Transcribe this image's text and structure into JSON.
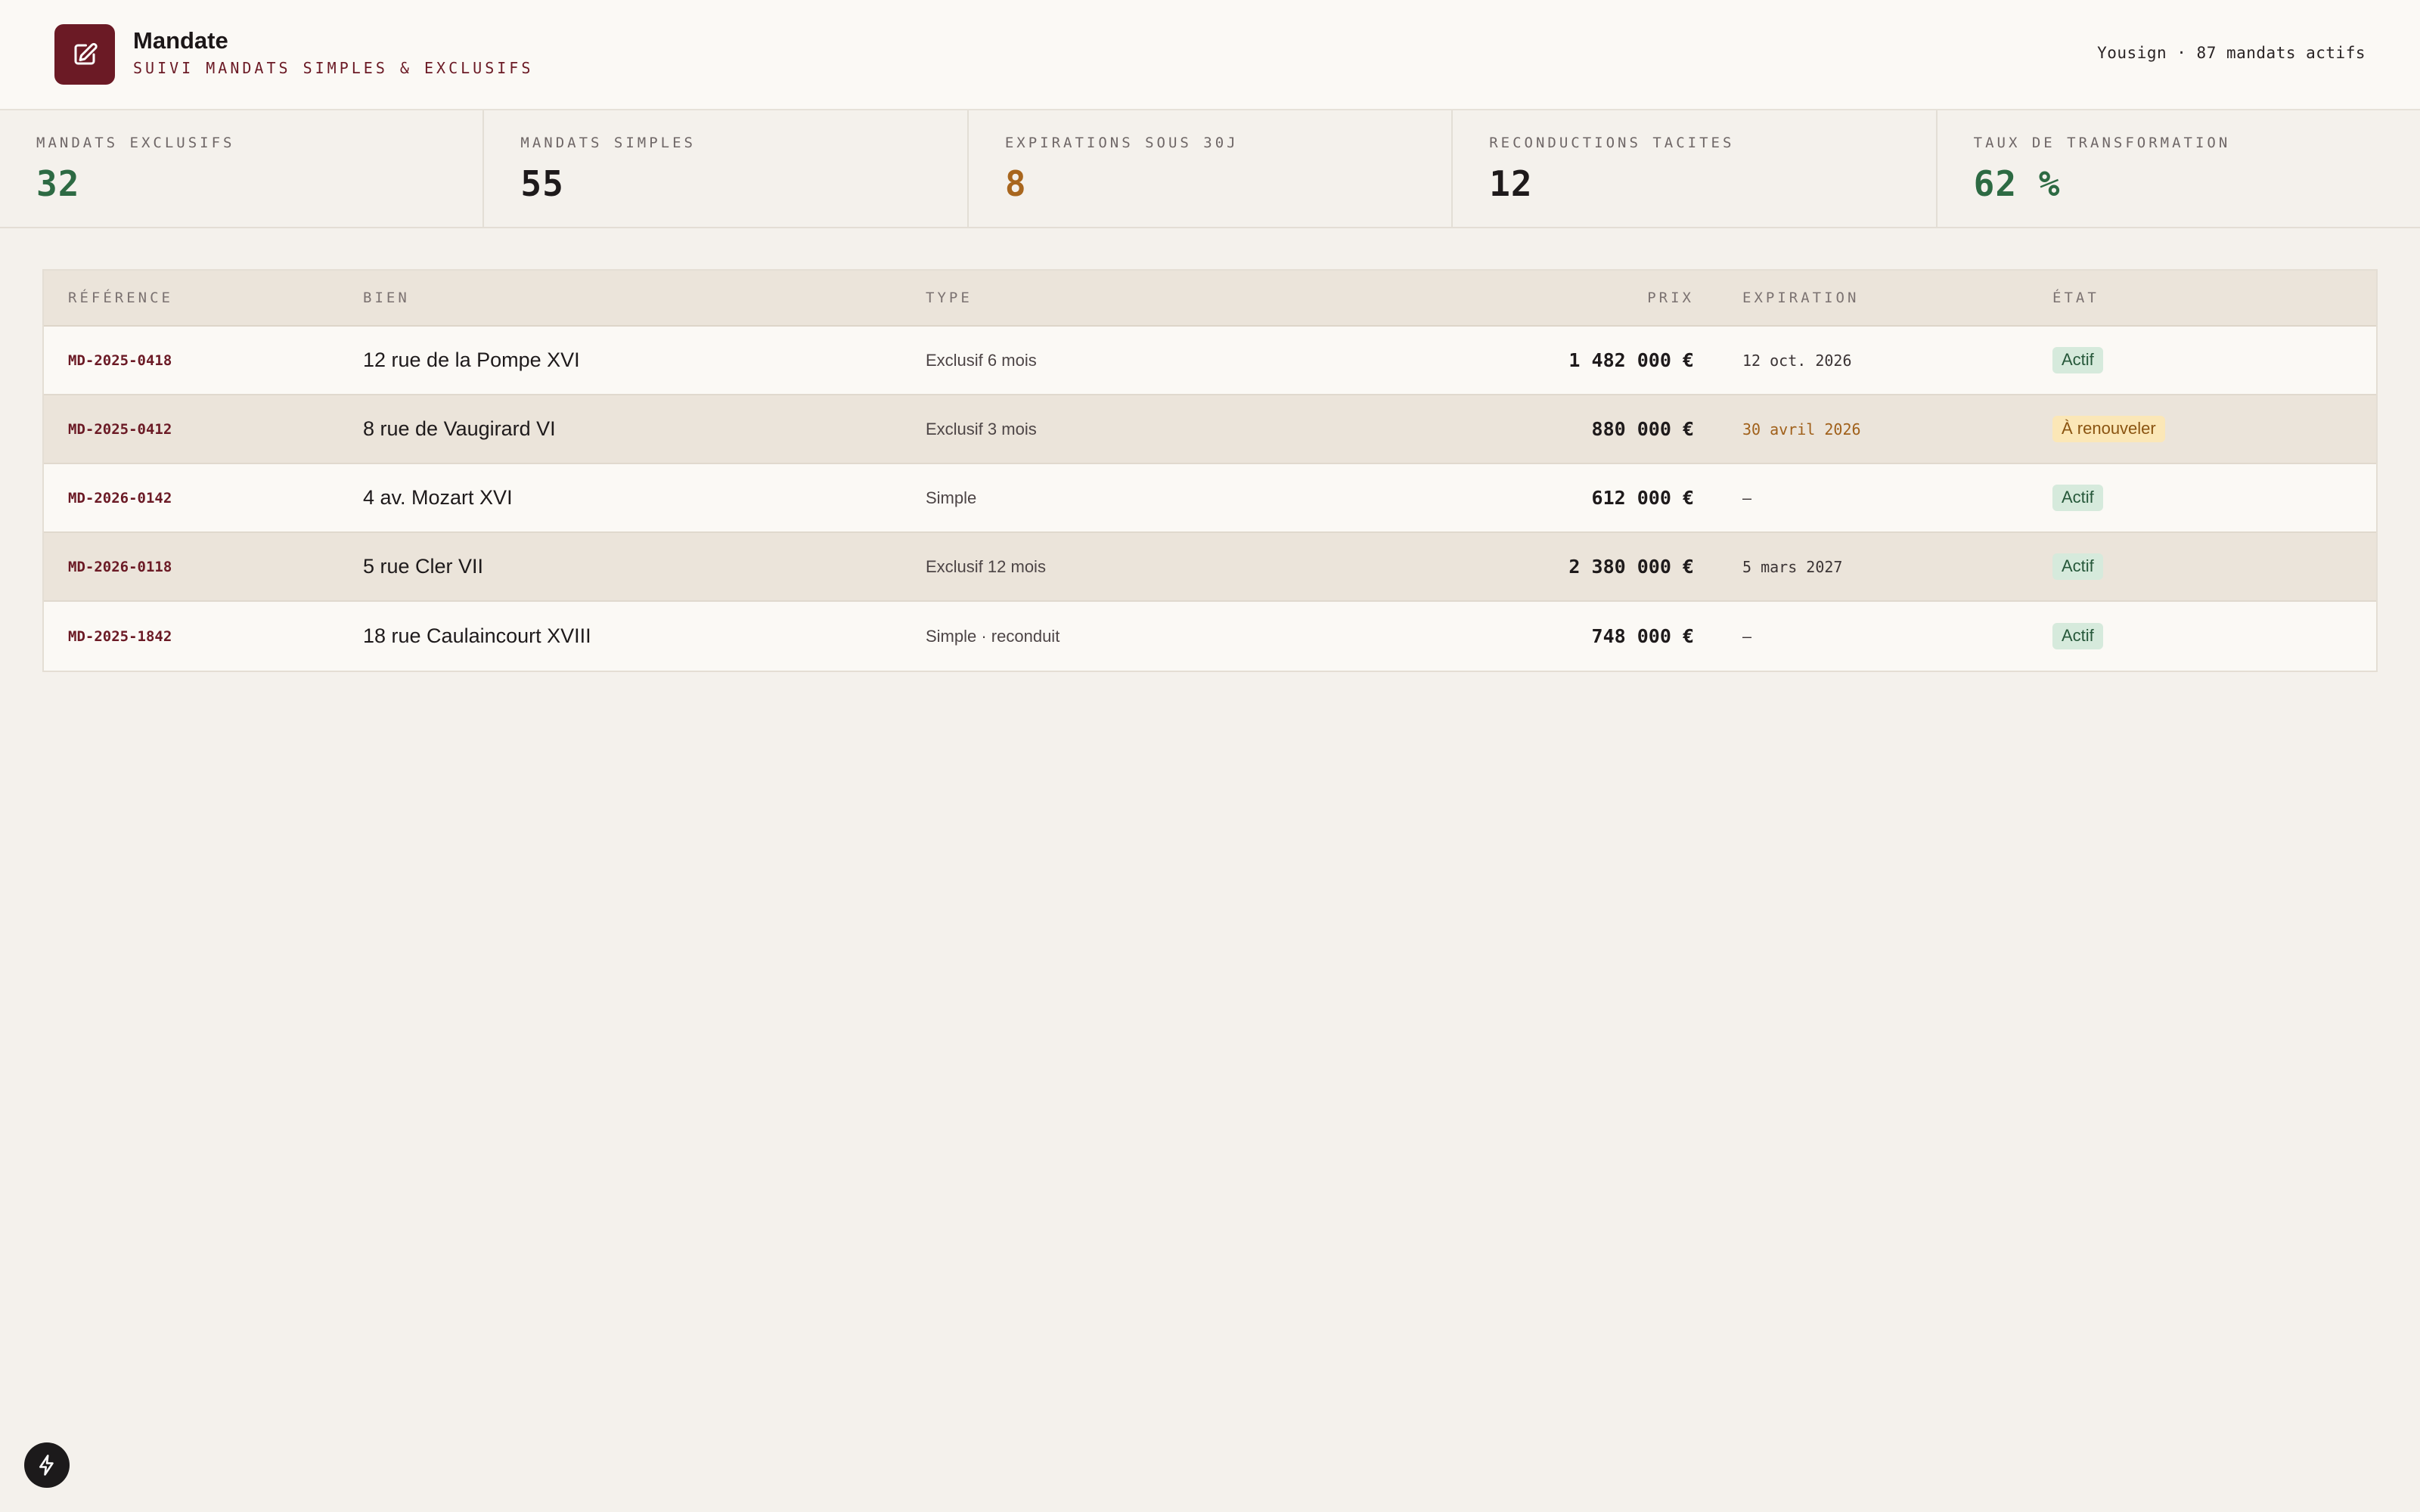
{
  "app": {
    "title": "Mandate",
    "subtitle": "SUIVI MANDATS SIMPLES & EXCLUSIFS",
    "meta": "Yousign · 87 mandats actifs",
    "logo_icon": "document-edit-icon",
    "brand_color": "#6b1a25"
  },
  "kpis": [
    {
      "label": "MANDATS EXCLUSIFS",
      "value": "32",
      "color": "#2d6a43"
    },
    {
      "label": "MANDATS SIMPLES",
      "value": "55",
      "color": "#1e1a1b"
    },
    {
      "label": "EXPIRATIONS SOUS 30J",
      "value": "8",
      "color": "#a8661e"
    },
    {
      "label": "RECONDUCTIONS TACITES",
      "value": "12",
      "color": "#1e1a1b"
    },
    {
      "label": "TAUX DE TRANSFORMATION",
      "value": "62 %",
      "color": "#2d6a43"
    }
  ],
  "table": {
    "headers": {
      "ref": "RÉFÉRENCE",
      "bien": "BIEN",
      "type": "TYPE",
      "prix": "PRIX",
      "expiration": "EXPIRATION",
      "etat": "ÉTAT"
    },
    "rows": [
      {
        "ref": "MD-2025-0418",
        "bien": "12 rue de la Pompe XVI",
        "type": "Exclusif 6 mois",
        "prix": "1 482 000 €",
        "expiration": "12 oct. 2026",
        "expiration_warn": false,
        "etat": "Actif",
        "etat_status": "ok"
      },
      {
        "ref": "MD-2025-0412",
        "bien": "8 rue de Vaugirard VI",
        "type": "Exclusif 3 mois",
        "prix": "880 000 €",
        "expiration": "30 avril 2026",
        "expiration_warn": true,
        "etat": "À renouveler",
        "etat_status": "warn"
      },
      {
        "ref": "MD-2026-0142",
        "bien": "4 av. Mozart XVI",
        "type": "Simple",
        "prix": "612 000 €",
        "expiration": "–",
        "expiration_warn": false,
        "etat": "Actif",
        "etat_status": "ok"
      },
      {
        "ref": "MD-2026-0118",
        "bien": "5 rue Cler VII",
        "type": "Exclusif 12 mois",
        "prix": "2 380 000 €",
        "expiration": "5 mars 2027",
        "expiration_warn": false,
        "etat": "Actif",
        "etat_status": "ok"
      },
      {
        "ref": "MD-2025-1842",
        "bien": "18 rue Caulaincourt XVIII",
        "type": "Simple · reconduit",
        "prix": "748 000 €",
        "expiration": "–",
        "expiration_warn": false,
        "etat": "Actif",
        "etat_status": "ok"
      }
    ]
  },
  "fab": {
    "icon": "lightning-icon"
  }
}
